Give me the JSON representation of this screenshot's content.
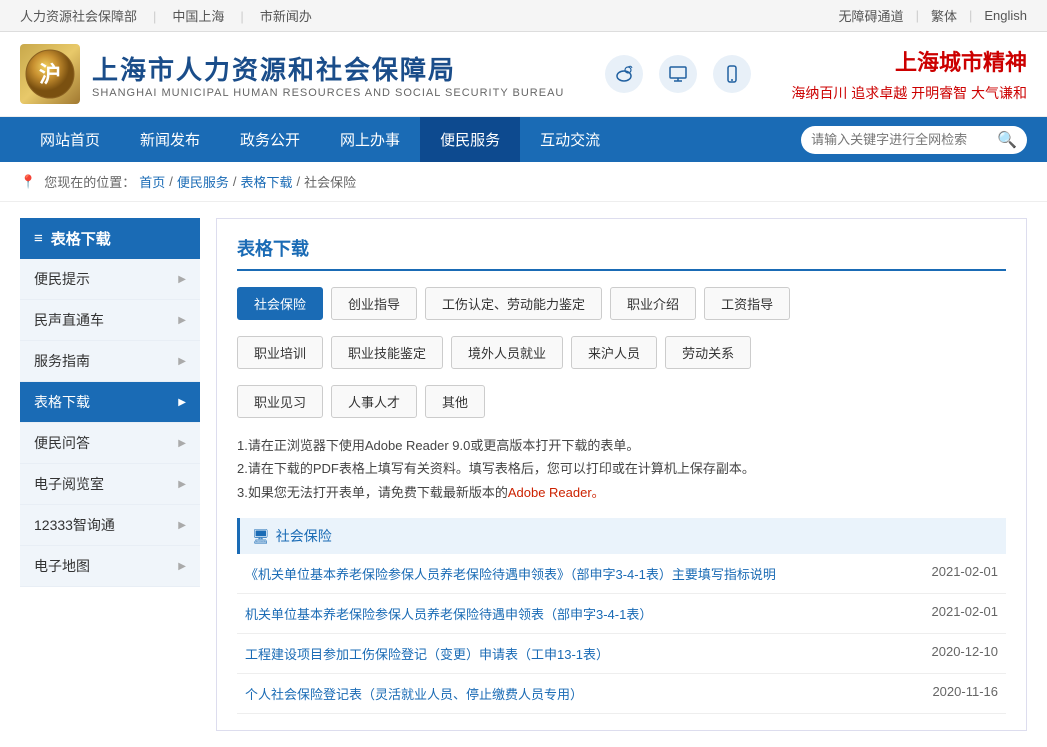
{
  "topbar": {
    "left_links": [
      "人力资源社会保障部",
      "中国上海",
      "市新闻办"
    ],
    "right_links": [
      "无障碍通道",
      "繁体",
      "English"
    ]
  },
  "header": {
    "logo_char": "沪",
    "title": "上海市人力资源和社会保障局",
    "subtitle": "SHANGHAI MUNICIPAL HUMAN RESOURCES AND SOCIAL SECURITY BUREAU",
    "city_spirit_title": "上海城市精神",
    "city_spirit_sub": "海纳百川 追求卓越 开明睿智 大气谦和",
    "icons": [
      "微博",
      "电脑",
      "手机"
    ]
  },
  "nav": {
    "items": [
      "网站首页",
      "新闻发布",
      "政务公开",
      "网上办事",
      "便民服务",
      "互动交流"
    ],
    "active": "便民服务",
    "search_placeholder": "请输入关键字进行全网检索"
  },
  "breadcrumb": {
    "label": "您现在的位置：",
    "items": [
      "首页",
      "便民服务",
      "表格下载",
      "社会保险"
    ]
  },
  "sidebar": {
    "title": "表格下载",
    "items": [
      {
        "label": "便民提示",
        "active": false
      },
      {
        "label": "民声直通车",
        "active": false
      },
      {
        "label": "服务指南",
        "active": false
      },
      {
        "label": "表格下载",
        "active": true
      },
      {
        "label": "便民问答",
        "active": false
      },
      {
        "label": "电子阅览室",
        "active": false
      },
      {
        "label": "12333智询通",
        "active": false
      },
      {
        "label": "电子地图",
        "active": false
      }
    ]
  },
  "content": {
    "title": "表格下载",
    "categories_row1": [
      {
        "label": "社会保险",
        "active": true
      },
      {
        "label": "创业指导",
        "active": false
      },
      {
        "label": "工伤认定、劳动能力鉴定",
        "active": false
      },
      {
        "label": "职业介绍",
        "active": false
      },
      {
        "label": "工资指导",
        "active": false
      }
    ],
    "categories_row2": [
      {
        "label": "职业培训",
        "active": false
      },
      {
        "label": "职业技能鉴定",
        "active": false
      },
      {
        "label": "境外人员就业",
        "active": false
      },
      {
        "label": "来沪人员",
        "active": false
      },
      {
        "label": "劳动关系",
        "active": false
      }
    ],
    "categories_row3": [
      {
        "label": "职业见习",
        "active": false
      },
      {
        "label": "人事人才",
        "active": false
      },
      {
        "label": "其他",
        "active": false
      }
    ],
    "instructions": [
      "1.请在正浏览器下使用Adobe Reader 9.0或更高版本打开下载的表单。",
      "2.请在下载的PDF表格上填写有关资料。填写表格后，您可以打印或在计算机上保存副本。",
      "3.如果您无法打开表单，请免费下载最新版本的"
    ],
    "adobe_link_text": "Adobe Reader。",
    "section_icon": "🖥",
    "section_label": "社会保险",
    "forms": [
      {
        "name": "《机关单位基本养老保险参保人员养老保险待遇申领表》（部申字3-4-1表）主要填写指标说明",
        "date": "2021-02-01"
      },
      {
        "name": "机关单位基本养老保险参保人员养老保险待遇申领表（部申字3-4-1表）",
        "date": "2021-02-01"
      },
      {
        "name": "工程建设项目参加工伤保险登记（变更）申请表（工申13-1表）",
        "date": "2020-12-10"
      },
      {
        "name": "个人社会保险登记表（灵活就业人员、停止缴费人员专用）",
        "date": "2020-11-16"
      }
    ]
  }
}
